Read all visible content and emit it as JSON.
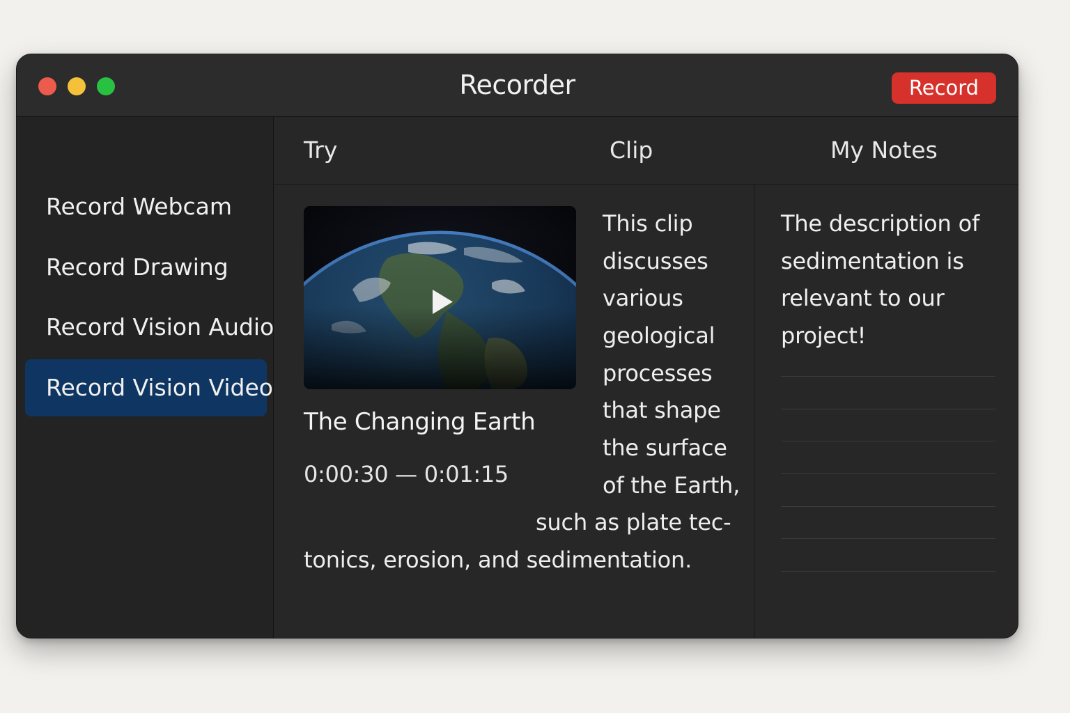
{
  "window": {
    "title": "Recorder",
    "record_label": "Record"
  },
  "sidebar": {
    "items": [
      {
        "label": "Record Webcam",
        "active": false
      },
      {
        "label": "Record Drawing",
        "active": false
      },
      {
        "label": "Record Vision Audio",
        "active": false
      },
      {
        "label": "Record Vision Video",
        "active": true
      }
    ]
  },
  "tabs": [
    "Try",
    "Clip",
    "My Notes"
  ],
  "clip": {
    "title": "The Changing Earth",
    "time_range": "0:00:30 — 0:01:15",
    "thumbnail_icon": "play-icon",
    "description_lines": [
      "This clip",
      "discusses",
      "various",
      "geological",
      "processes",
      "that shape",
      "the surface",
      "of the Earth,",
      "such as plate tec-",
      "tonics, erosion, and sedimentation."
    ]
  },
  "notes": {
    "lines": [
      "The description of",
      "sedimentation is",
      "relevant to our",
      "project!"
    ]
  },
  "colors": {
    "accent_record": "#d7312b",
    "sidebar_active": "#0f3663",
    "traffic_close": "#ed5b4c",
    "traffic_minimize": "#f5c13a",
    "traffic_maximize": "#29c141"
  }
}
